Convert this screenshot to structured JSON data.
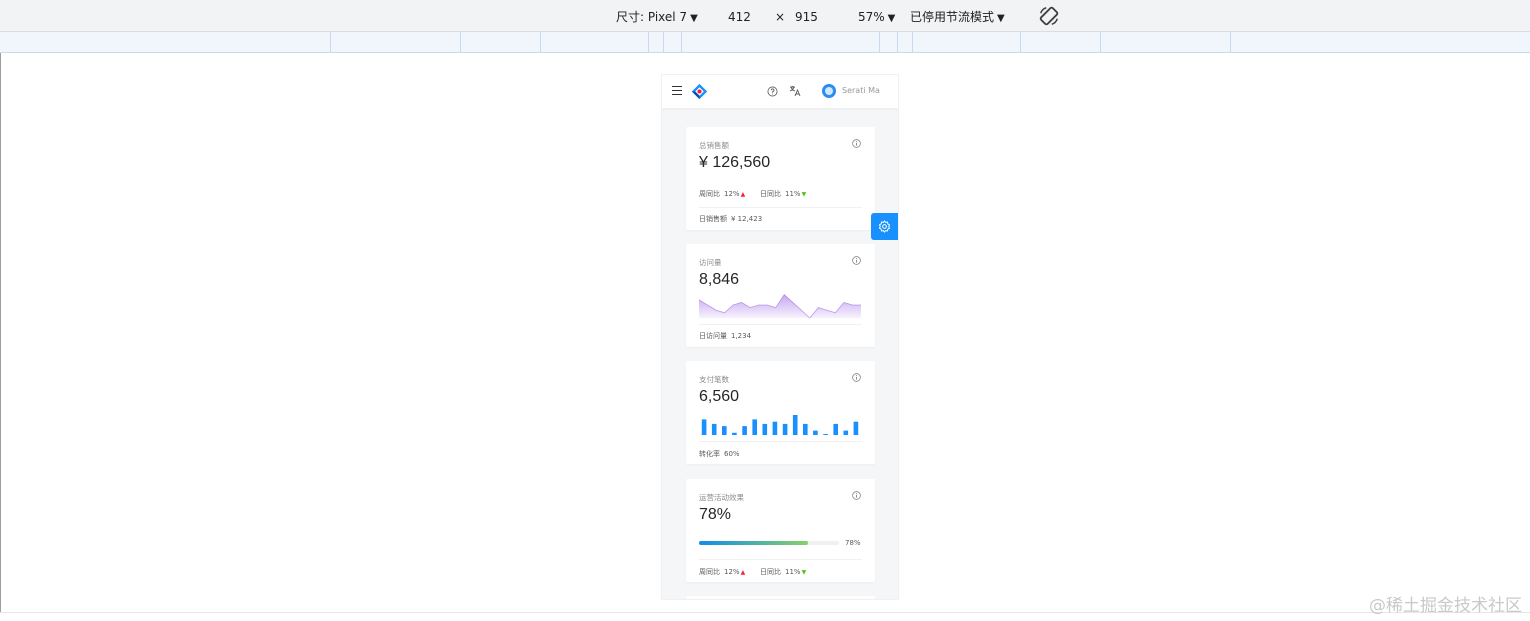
{
  "devtools": {
    "size_label": "尺寸: Pixel 7",
    "width": "412",
    "times": "×",
    "height": "915",
    "zoom": "57%",
    "throttle": "已停用节流模式"
  },
  "header": {
    "username": "Serati Ma"
  },
  "cards": {
    "sales": {
      "title": "总销售额",
      "value": "¥ 126,560",
      "week_label": "周同比",
      "week_value": "12%",
      "day_label": "日同比",
      "day_value": "11%",
      "footer_label": "日销售额",
      "footer_value": "¥ 12,423"
    },
    "visits": {
      "title": "访问量",
      "value": "8,846",
      "footer_label": "日访问量",
      "footer_value": "1,234"
    },
    "payments": {
      "title": "支付笔数",
      "value": "6,560",
      "footer_label": "转化率",
      "footer_value": "60%"
    },
    "campaign": {
      "title": "运营活动效果",
      "value": "78%",
      "progress": 78,
      "progress_label": "78%",
      "week_label": "周同比",
      "week_value": "12%",
      "day_label": "日同比",
      "day_value": "11%"
    }
  },
  "chart_data": [
    {
      "type": "area",
      "x": [
        1,
        2,
        3,
        4,
        5,
        6,
        7,
        8,
        9,
        10,
        11,
        12,
        13,
        14,
        15,
        16,
        17,
        18,
        19,
        20
      ],
      "values": [
        7,
        5,
        3,
        2,
        5,
        6,
        4,
        5,
        5,
        4,
        9,
        6,
        3,
        0,
        4,
        3,
        2,
        6,
        5,
        5
      ],
      "color": "#975fe4"
    },
    {
      "type": "bar",
      "x": [
        1,
        2,
        3,
        4,
        5,
        6,
        7,
        8,
        9,
        10,
        11,
        12,
        13,
        14,
        15,
        16
      ],
      "values": [
        7,
        5,
        4,
        1,
        4,
        7,
        5,
        6,
        5,
        9,
        5,
        2,
        0,
        5,
        2,
        6
      ],
      "color": "#1890ff"
    }
  ],
  "watermark": "@稀土掘金技术社区"
}
